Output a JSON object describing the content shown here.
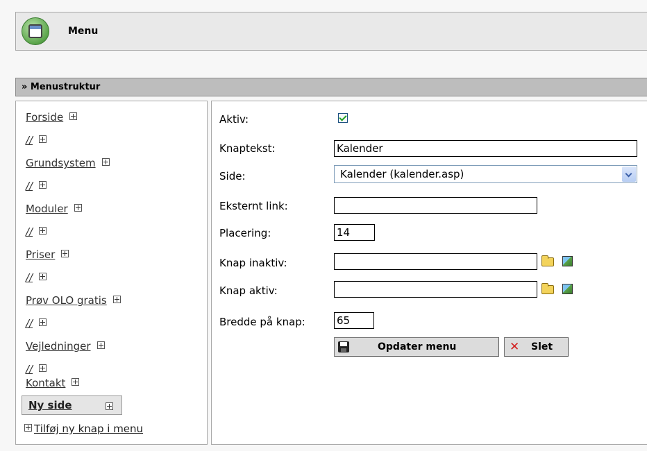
{
  "header": {
    "title": "Menu",
    "icon": "window-app-icon"
  },
  "section": {
    "title": "» Menustruktur"
  },
  "tree": {
    "items": [
      {
        "label": "Forside"
      },
      {
        "label": "//"
      },
      {
        "label": "Grundsystem"
      },
      {
        "label": "//"
      },
      {
        "label": "Moduler"
      },
      {
        "label": "//"
      },
      {
        "label": "Priser"
      },
      {
        "label": "//"
      },
      {
        "label": "Prøv OLO gratis"
      },
      {
        "label": "//"
      },
      {
        "label": "Vejledninger"
      },
      {
        "label": "//"
      },
      {
        "label": "Kontakt"
      }
    ],
    "selected": {
      "label": "Ny side"
    },
    "add_label": "Tilføj ny knap i menu"
  },
  "form": {
    "aktiv_label": "Aktiv:",
    "aktiv_checked": true,
    "knaptekst_label": "Knaptekst:",
    "knaptekst_value": "Kalender",
    "side_label": "Side:",
    "side_value": "Kalender (kalender.asp)",
    "eksternt_label": "Eksternt link:",
    "eksternt_value": "",
    "placering_label": "Placering:",
    "placering_value": "14",
    "knap_inaktiv_label": "Knap inaktiv:",
    "knap_inaktiv_value": "",
    "knap_aktiv_label": "Knap aktiv:",
    "knap_aktiv_value": "",
    "bredde_label": "Bredde på knap:",
    "bredde_value": "65",
    "update_label": "Opdater menu",
    "delete_label": "Slet"
  },
  "colors": {
    "header_bg": "#e9e9e9",
    "section_bg": "#bdbdbd",
    "check_green": "#21a121",
    "delete_red": "#d32020"
  }
}
